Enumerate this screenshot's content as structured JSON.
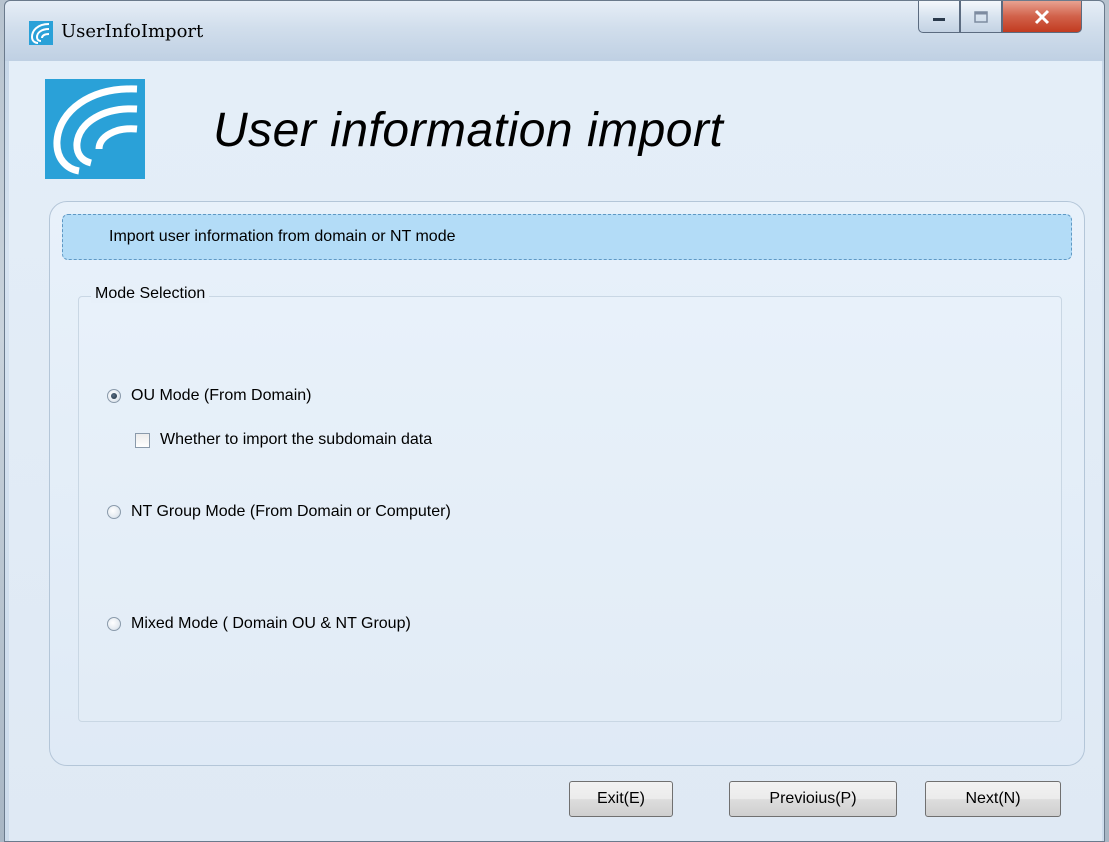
{
  "window": {
    "title": "UserInfoImport"
  },
  "header": {
    "heading": "User information import"
  },
  "banner": {
    "text": "Import user information from domain or NT mode"
  },
  "mode_selection": {
    "legend": "Mode Selection",
    "options": [
      {
        "label": "OU Mode (From Domain)",
        "checked": true
      },
      {
        "label": "NT Group Mode (From Domain or Computer)",
        "checked": false
      },
      {
        "label": "Mixed Mode ( Domain OU &  NT Group)",
        "checked": false
      }
    ],
    "subdomain_checkbox": {
      "label": "Whether to import the subdomain data",
      "checked": false
    }
  },
  "buttons": {
    "exit": "Exit(E)",
    "previous": "Previoius(P)",
    "next": "Next(N)"
  },
  "colors": {
    "banner_bg": "#b3dcf7",
    "logo_blue": "#2aa1d8",
    "close_red": "#c23b20"
  }
}
